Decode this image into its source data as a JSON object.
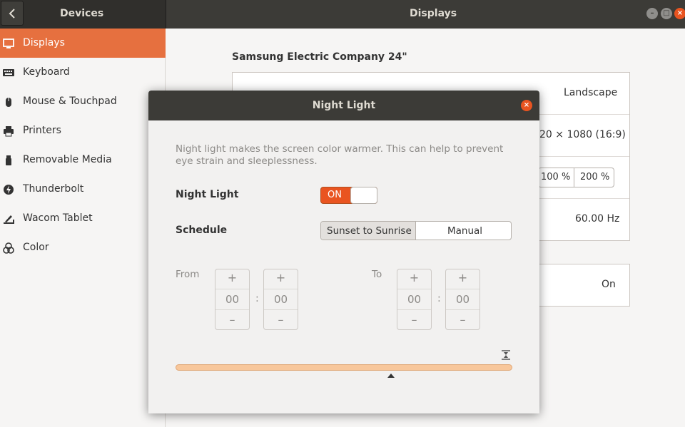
{
  "header": {
    "left_title": "Devices",
    "right_title": "Displays"
  },
  "sidebar": {
    "items": [
      {
        "label": "Displays",
        "icon": "display-icon",
        "active": true
      },
      {
        "label": "Keyboard",
        "icon": "keyboard-icon"
      },
      {
        "label": "Mouse & Touchpad",
        "icon": "mouse-icon"
      },
      {
        "label": "Printers",
        "icon": "printer-icon"
      },
      {
        "label": "Removable Media",
        "icon": "media-icon"
      },
      {
        "label": "Thunderbolt",
        "icon": "thunderbolt-icon"
      },
      {
        "label": "Wacom Tablet",
        "icon": "tablet-icon"
      },
      {
        "label": "Color",
        "icon": "color-icon"
      }
    ]
  },
  "main": {
    "monitor_title": "Samsung Electric Company 24\"",
    "orientation": "Landscape",
    "resolution": "20 × 1080 (16:9)",
    "scale_options": [
      "100 %",
      "200 %"
    ],
    "refresh_rate": "60.00 Hz",
    "night_light_status": "On"
  },
  "dialog": {
    "title": "Night Light",
    "description": "Night light makes the screen color warmer. This can help to prevent eye strain and sleeplessness.",
    "night_light_label": "Night Light",
    "toggle_on_label": "ON",
    "schedule_label": "Schedule",
    "schedule_options": [
      "Sunset to Sunrise",
      "Manual"
    ],
    "from_label": "From",
    "to_label": "To",
    "plus": "+",
    "minus": "–",
    "colon": ":",
    "from_hours": "00",
    "from_minutes": "00",
    "to_hours": "00",
    "to_minutes": "00"
  },
  "colors": {
    "accent": "#e95420",
    "header": "#3c3b37",
    "slider": "#f8c79b"
  }
}
